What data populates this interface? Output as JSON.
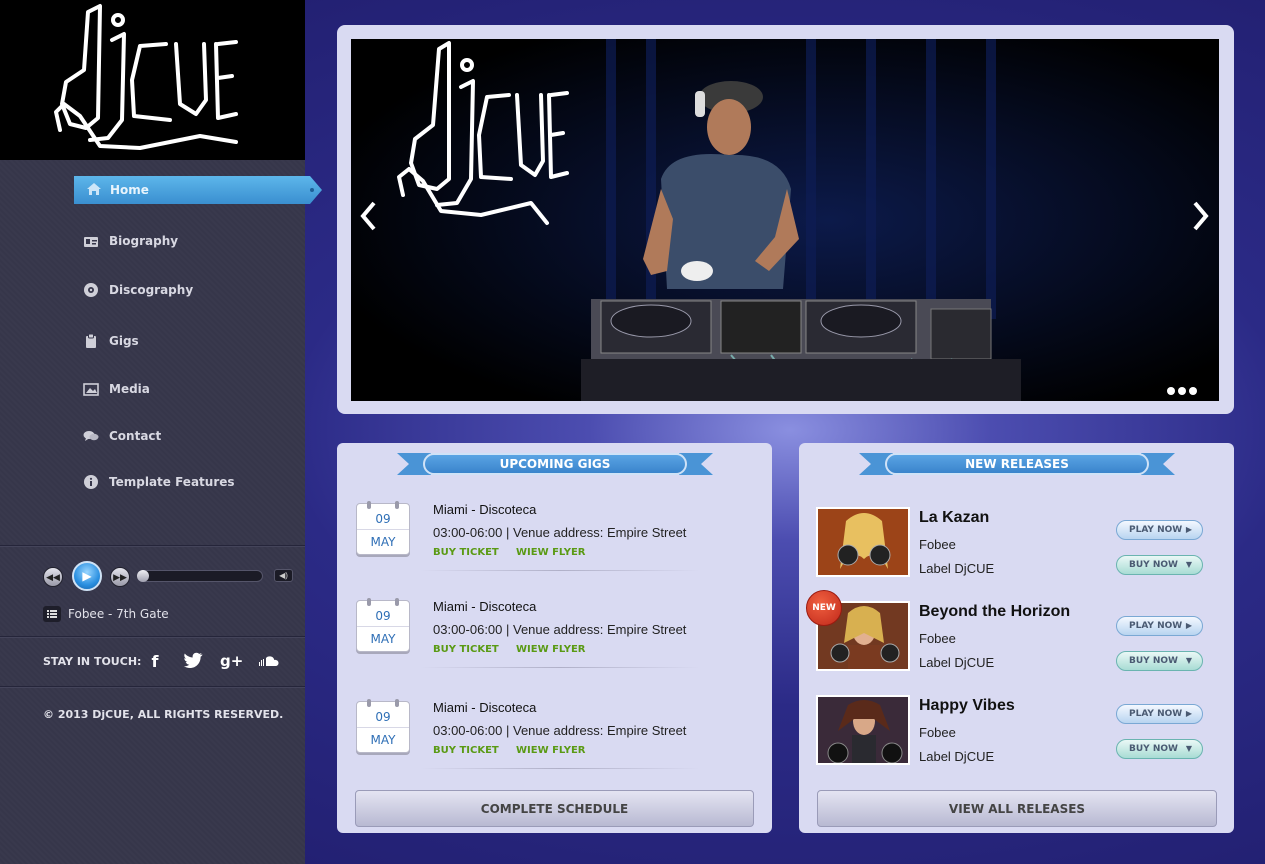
{
  "nav": {
    "items": [
      {
        "label": "Home",
        "icon": "home-icon"
      },
      {
        "label": "Biography",
        "icon": "id-card-icon"
      },
      {
        "label": "Discography",
        "icon": "disc-icon"
      },
      {
        "label": "Gigs",
        "icon": "clipboard-icon"
      },
      {
        "label": "Media",
        "icon": "image-icon"
      },
      {
        "label": "Contact",
        "icon": "chat-bubbles-icon"
      },
      {
        "label": "Template Features",
        "icon": "info-icon"
      }
    ]
  },
  "player": {
    "track": "Fobee - 7th Gate",
    "progress": 0
  },
  "social": {
    "label": "STAY IN TOUCH:",
    "icons": [
      "facebook-icon",
      "twitter-icon",
      "google-plus-icon",
      "soundcloud-icon"
    ]
  },
  "footer": {
    "copyright": "© 2013 DjCUE, ALL RIGHTS RESERVED."
  },
  "gigs": {
    "heading": "UPCOMING GIGS",
    "items": [
      {
        "day": "09",
        "month": "MAY",
        "title": "Miami - Discoteca",
        "info": "03:00-06:00 | Venue address: Empire Street",
        "buy": "BUY TICKET",
        "flyer": "WIEW FLYER"
      },
      {
        "day": "09",
        "month": "MAY",
        "title": "Miami - Discoteca",
        "info": "03:00-06:00 | Venue address: Empire Street",
        "buy": "BUY TICKET",
        "flyer": "WIEW FLYER"
      },
      {
        "day": "09",
        "month": "MAY",
        "title": "Miami - Discoteca",
        "info": "03:00-06:00 | Venue address: Empire Street",
        "buy": "BUY TICKET",
        "flyer": "WIEW FLYER"
      }
    ],
    "button": "COMPLETE SCHEDULE"
  },
  "releases": {
    "heading": "NEW RELEASES",
    "badge": "NEW",
    "items": [
      {
        "title": "La Kazan",
        "artist": "Fobee",
        "label": "Label DjCUE",
        "play": "PLAY NOW",
        "buy": "BUY NOW"
      },
      {
        "title": "Beyond the Horizon",
        "artist": "Fobee",
        "label": "Label DjCUE",
        "play": "PLAY NOW",
        "buy": "BUY NOW"
      },
      {
        "title": "Happy Vibes",
        "artist": "Fobee",
        "label": "Label DjCUE",
        "play": "PLAY NOW",
        "buy": "BUY NOW"
      }
    ],
    "button": "VIEW ALL RELEASES"
  },
  "brand": {
    "logo_text": "djcue",
    "accent": "#3a8fd0",
    "link_green": "#5a9a14"
  }
}
